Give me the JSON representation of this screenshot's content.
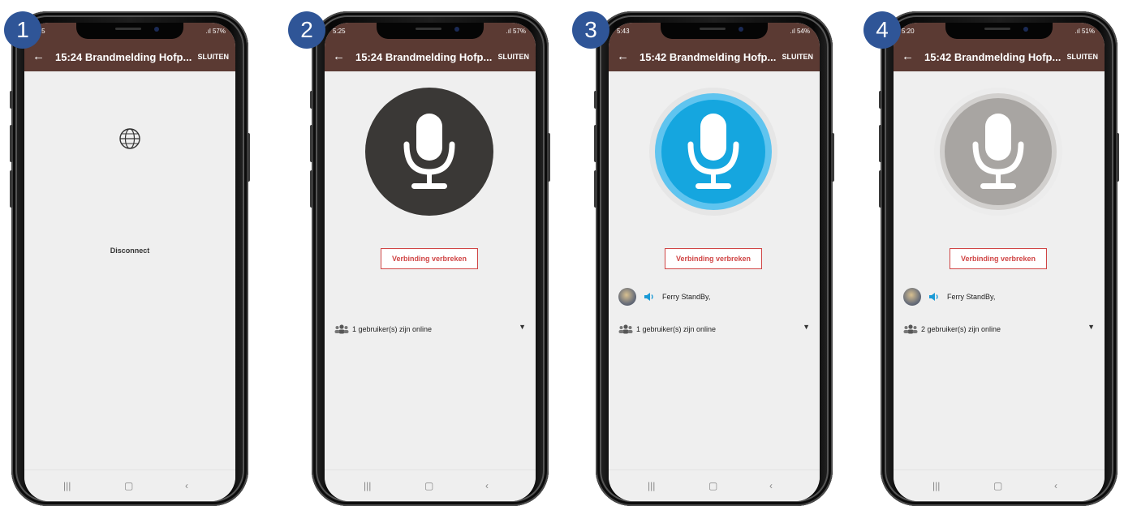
{
  "phones": [
    {
      "step": "1",
      "status_time": "5:25",
      "status_right": "57%",
      "title": "15:24 Brandmelding Hofp...",
      "close_label": "SLUITEN",
      "disconnect_text": "Disconnect"
    },
    {
      "step": "2",
      "status_time": "5:25",
      "status_right": "57%",
      "title": "15:24 Brandmelding Hofp...",
      "close_label": "SLUITEN",
      "button_label": "Verbinding verbreken",
      "online_label": "1 gebruiker(s) zijn online",
      "mic_color": "#3a3836"
    },
    {
      "step": "3",
      "status_time": "5:43",
      "status_right": "54%",
      "title": "15:42 Brandmelding Hofp...",
      "close_label": "SLUITEN",
      "button_label": "Verbinding verbreken",
      "user_name": "Ferry StandBy,",
      "online_label": "1 gebruiker(s) zijn online",
      "mic_color": "#15a6df"
    },
    {
      "step": "4",
      "status_time": "5:20",
      "status_right": "51%",
      "title": "15:42 Brandmelding Hofp...",
      "close_label": "SLUITEN",
      "button_label": "Verbinding verbreken",
      "user_name": "Ferry StandBy,",
      "online_label": "2 gebruiker(s) zijn online",
      "mic_color": "#a8a5a2"
    }
  ],
  "icons": {
    "back": "arrow-left-icon",
    "globe": "globe-icon",
    "mic": "microphone-icon",
    "speaker": "speaker-icon",
    "group": "users-group-icon",
    "dropdown": "caret-down-icon"
  },
  "colors": {
    "appbar": "#5b3a33",
    "badge": "#2f5597",
    "button_border": "#d04545",
    "speaker_blue": "#1a9ad6"
  }
}
